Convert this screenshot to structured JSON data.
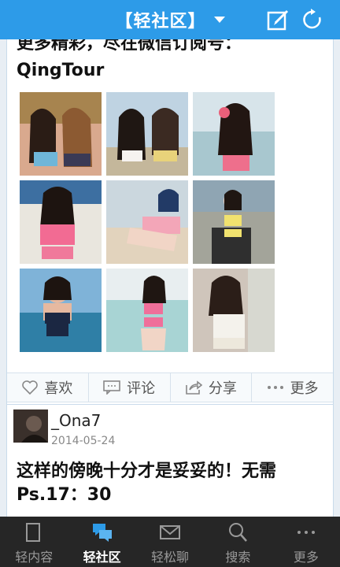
{
  "header": {
    "title": "【轻社区】",
    "edit_icon": "compose-icon",
    "refresh_icon": "refresh-icon",
    "background": "#2d9be8"
  },
  "post1": {
    "text_line1": "更多精彩，尽在微信订阅号：",
    "text_line2": "QingTour",
    "photo_count": 9
  },
  "actions": [
    {
      "icon": "heart-icon",
      "label": "喜欢"
    },
    {
      "icon": "comment-icon",
      "label": "评论"
    },
    {
      "icon": "share-icon",
      "label": "分享"
    },
    {
      "icon": "more-dots-icon",
      "label": "更多"
    }
  ],
  "post2": {
    "username": "_Ona7",
    "date": "2014-05-24",
    "text_line1": "这样的傍晚十分才是妥妥的！无需",
    "text_line2": "Ps.17：30"
  },
  "bottom_nav": [
    {
      "icon": "document-icon",
      "label": "轻内容",
      "active": false
    },
    {
      "icon": "chat-bubbles-icon",
      "label": "轻社区",
      "active": true
    },
    {
      "icon": "mail-icon",
      "label": "轻松聊",
      "active": false
    },
    {
      "icon": "search-icon",
      "label": "搜索",
      "active": false
    },
    {
      "icon": "more-dots-icon",
      "label": "更多",
      "active": false
    }
  ]
}
